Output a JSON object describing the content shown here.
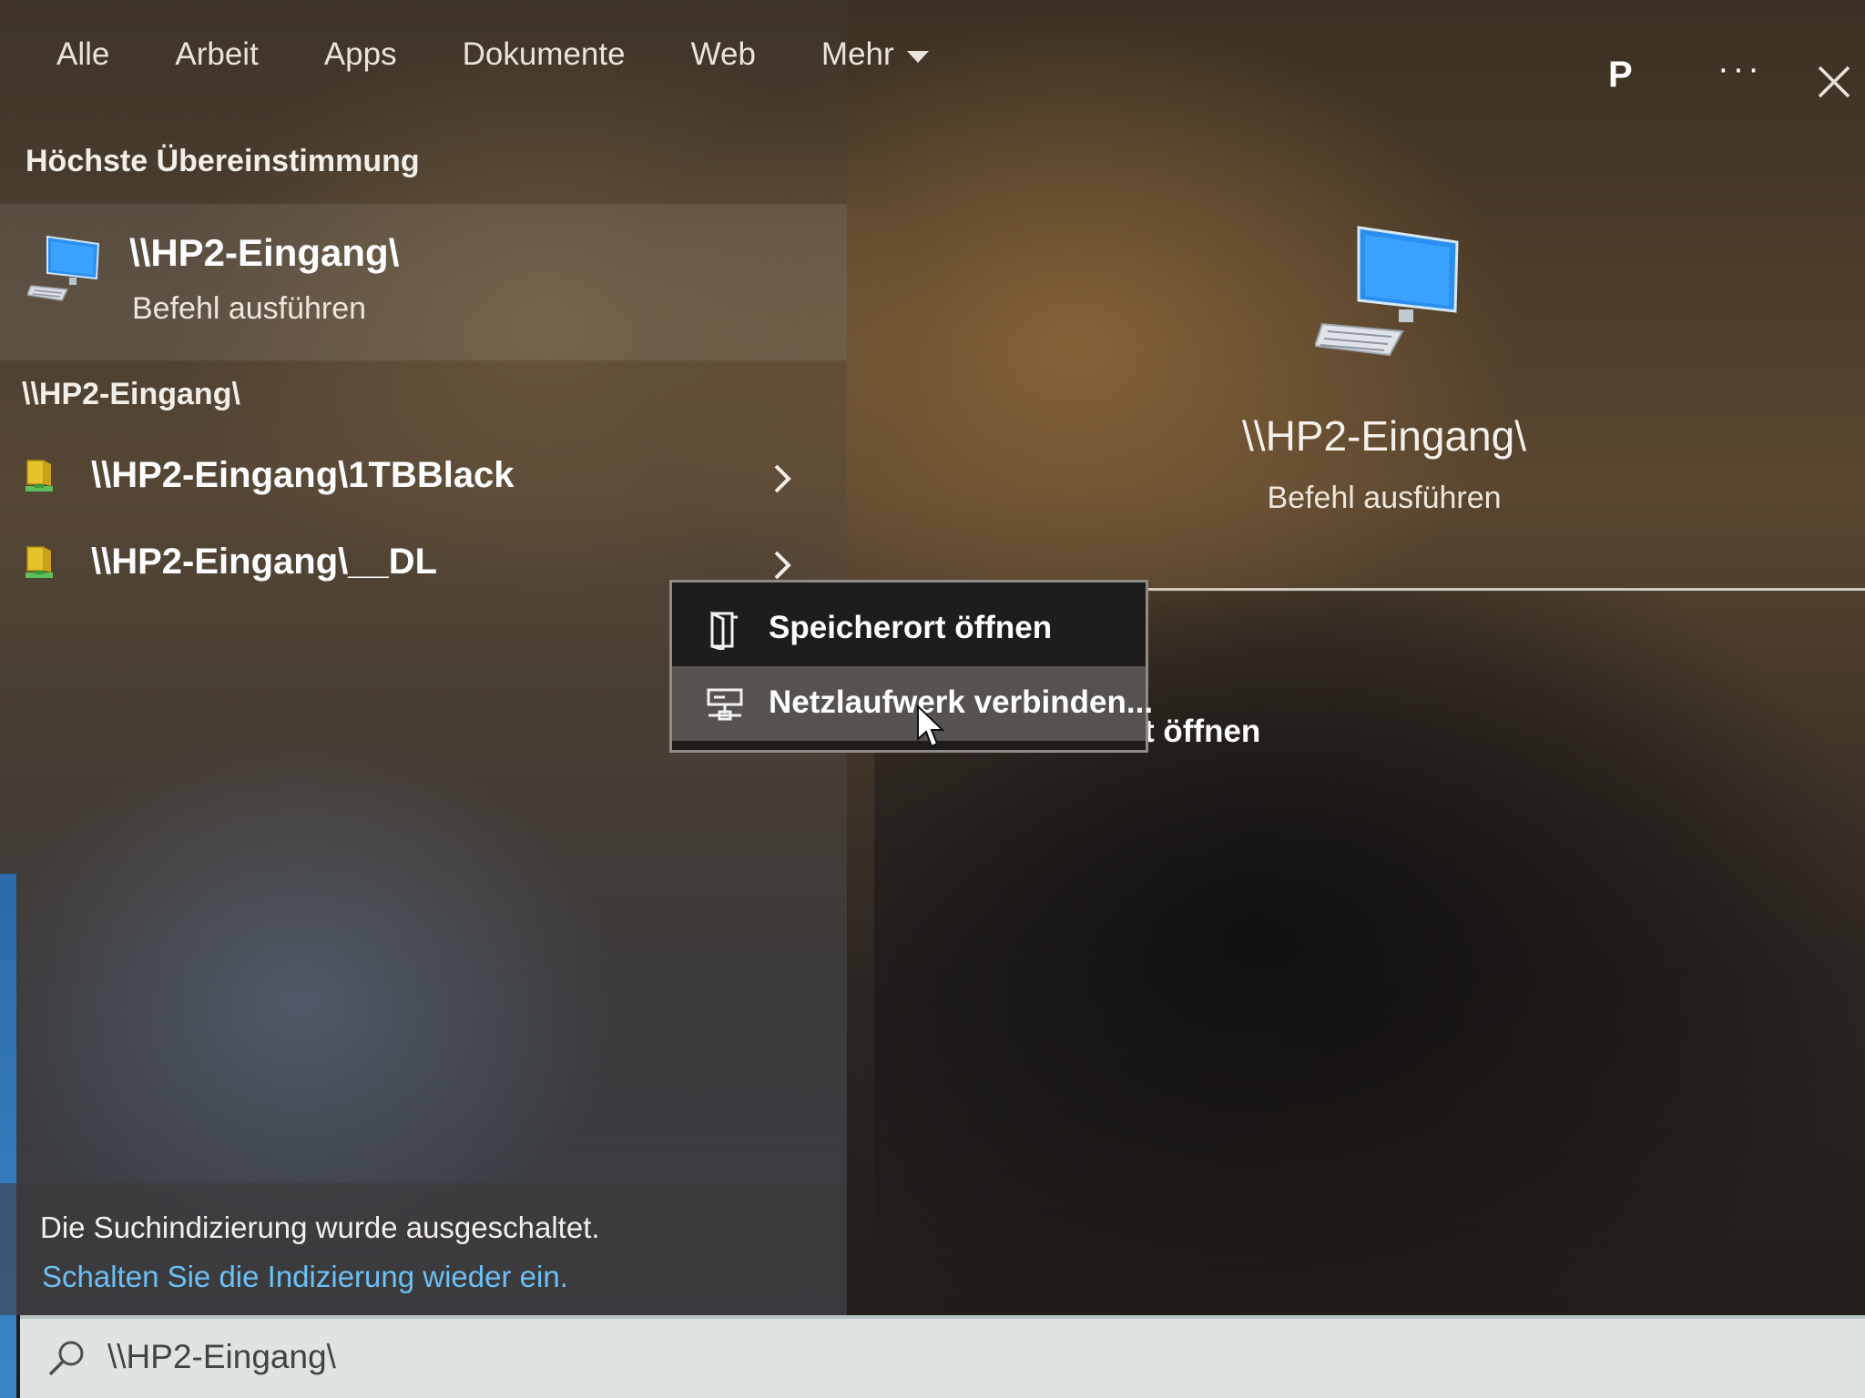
{
  "tabs": {
    "all": "Alle",
    "work": "Arbeit",
    "apps": "Apps",
    "documents": "Dokumente",
    "web": "Web",
    "more": "Mehr"
  },
  "header": {
    "avatar_initial": "P",
    "more_label": "···"
  },
  "best_match": {
    "section_title": "Höchste Übereinstimmung",
    "title": "\\\\HP2-Eingang\\",
    "subtitle": "Befehl ausführen",
    "icon": "computer-icon"
  },
  "results": {
    "group_title": "\\\\HP2-Eingang\\",
    "items": [
      {
        "label": "\\\\HP2-Eingang\\1TBBlack",
        "icon": "network-share-icon"
      },
      {
        "label": "\\\\HP2-Eingang\\__DL",
        "icon": "network-share-icon"
      }
    ]
  },
  "status": {
    "text": "Die Suchindizierung wurde ausgeschaltet.",
    "link": "Schalten Sie die Indizierung wieder ein."
  },
  "detail": {
    "title": "\\\\HP2-Eingang\\",
    "subtitle": "Befehl ausführen",
    "partial_action": "t öffnen"
  },
  "context_menu": {
    "items": [
      {
        "label": "Speicherort öffnen",
        "icon": "open-location-icon"
      },
      {
        "label": "Netzlaufwerk verbinden...",
        "icon": "map-network-drive-icon"
      }
    ],
    "hovered_index": 1
  },
  "search": {
    "value": "\\\\HP2-Eingang\\"
  },
  "colors": {
    "link": "#6cc0f4",
    "menu_bg": "#1f1d1c",
    "menu_hover": "#56524f"
  }
}
